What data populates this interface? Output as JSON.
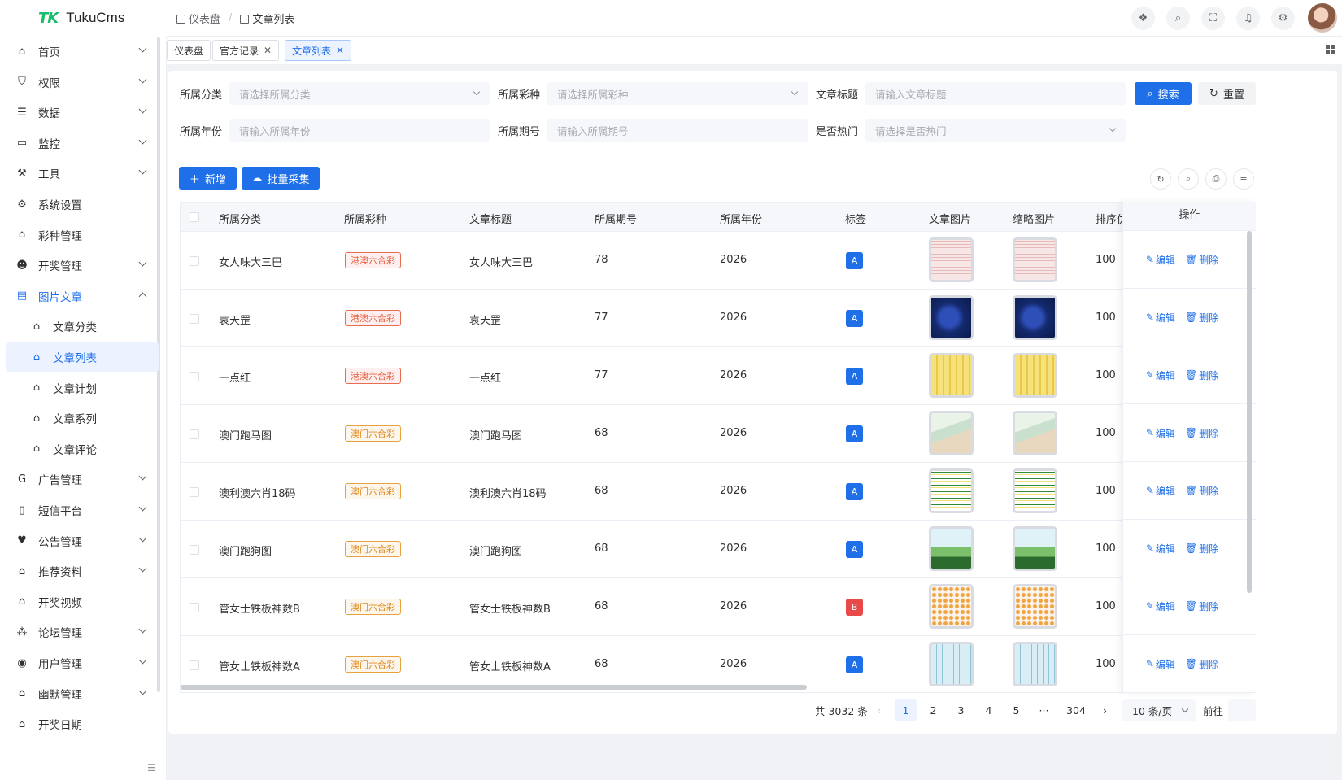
{
  "app": {
    "logo_mark": "TK",
    "name": "TukuCms"
  },
  "breadcrumb": [
    {
      "label": "仪表盘"
    },
    {
      "label": "文章列表"
    }
  ],
  "sidebar": {
    "items": [
      {
        "label": "首页",
        "icon": "home-icon",
        "expandable": true
      },
      {
        "label": "权限",
        "icon": "shield-icon",
        "expandable": true
      },
      {
        "label": "数据",
        "icon": "database-icon",
        "expandable": true
      },
      {
        "label": "监控",
        "icon": "monitor-icon",
        "expandable": true
      },
      {
        "label": "工具",
        "icon": "wrench-icon",
        "expandable": true
      },
      {
        "label": "系统设置",
        "icon": "gear-icon",
        "expandable": false
      },
      {
        "label": "彩种管理",
        "icon": "home-icon",
        "expandable": false
      },
      {
        "label": "开奖管理",
        "icon": "smile-icon",
        "expandable": true
      },
      {
        "label": "图片文章",
        "icon": "document-icon",
        "expandable": true,
        "open": true
      },
      {
        "label": "文章分类",
        "icon": "home-icon",
        "sub": true
      },
      {
        "label": "文章列表",
        "icon": "home-icon",
        "sub": true,
        "active": true
      },
      {
        "label": "文章计划",
        "icon": "home-icon",
        "sub": true
      },
      {
        "label": "文章系列",
        "icon": "home-icon",
        "sub": true
      },
      {
        "label": "文章评论",
        "icon": "home-icon",
        "sub": true
      },
      {
        "label": "广告管理",
        "icon": "google-icon",
        "expandable": true
      },
      {
        "label": "短信平台",
        "icon": "phone-icon",
        "expandable": true
      },
      {
        "label": "公告管理",
        "icon": "heart-icon",
        "expandable": true
      },
      {
        "label": "推荐资料",
        "icon": "home-icon",
        "expandable": true
      },
      {
        "label": "开奖视频",
        "icon": "home-icon",
        "expandable": false
      },
      {
        "label": "论坛管理",
        "icon": "network-icon",
        "expandable": true
      },
      {
        "label": "用户管理",
        "icon": "github-icon",
        "expandable": true
      },
      {
        "label": "幽默管理",
        "icon": "home-icon",
        "expandable": true
      },
      {
        "label": "开奖日期",
        "icon": "home-icon",
        "expandable": false
      }
    ]
  },
  "tabs": [
    {
      "label": "仪表盘",
      "closable": false
    },
    {
      "label": "官方记录",
      "closable": true
    },
    {
      "label": "文章列表",
      "closable": true,
      "active": true
    }
  ],
  "filters": {
    "category": {
      "label": "所属分类",
      "placeholder": "请选择所属分类"
    },
    "lottery": {
      "label": "所属彩种",
      "placeholder": "请选择所属彩种"
    },
    "title": {
      "label": "文章标题",
      "placeholder": "请输入文章标题"
    },
    "year": {
      "label": "所属年份",
      "placeholder": "请输入所属年份"
    },
    "issue": {
      "label": "所属期号",
      "placeholder": "请输入所属期号"
    },
    "hot": {
      "label": "是否热门",
      "placeholder": "请选择是否热门"
    },
    "search_label": "搜索",
    "reset_label": "重置"
  },
  "toolbar": {
    "add_label": "新增",
    "batch_label": "批量采集"
  },
  "table": {
    "columns": [
      "所属分类",
      "所属彩种",
      "文章标题",
      "所属期号",
      "所属年份",
      "标签",
      "文章图片",
      "缩略图片",
      "排序优",
      "操作"
    ],
    "edit_label": "编辑",
    "delete_label": "删除",
    "rows": [
      {
        "category": "女人味大三巴",
        "lottery": "港澳六合彩",
        "lottery_kind": "hk",
        "title": "女人味大三巴",
        "issue": "78",
        "year": "2026",
        "tag": "A",
        "sort": "100",
        "image_theme": "red-chart"
      },
      {
        "category": "袁天罡",
        "lottery": "港澳六合彩",
        "lottery_kind": "hk",
        "title": "袁天罡",
        "issue": "77",
        "year": "2026",
        "tag": "A",
        "sort": "100",
        "image_theme": "dark-blue"
      },
      {
        "category": "一点红",
        "lottery": "港澳六合彩",
        "lottery_kind": "hk",
        "title": "一点红",
        "issue": "77",
        "year": "2026",
        "tag": "A",
        "sort": "100",
        "image_theme": "yellow"
      },
      {
        "category": "澳门跑马图",
        "lottery": "澳门六合彩",
        "lottery_kind": "mo",
        "title": "澳门跑马图",
        "issue": "68",
        "year": "2026",
        "tag": "A",
        "sort": "100",
        "image_theme": "painting"
      },
      {
        "category": "澳利澳六肖18码",
        "lottery": "澳门六合彩",
        "lottery_kind": "mo",
        "title": "澳利澳六肖18码",
        "issue": "68",
        "year": "2026",
        "tag": "A",
        "sort": "100",
        "image_theme": "green-list"
      },
      {
        "category": "澳门跑狗图",
        "lottery": "澳门六合彩",
        "lottery_kind": "mo",
        "title": "澳门跑狗图",
        "issue": "68",
        "year": "2026",
        "tag": "A",
        "sort": "100",
        "image_theme": "cartoon"
      },
      {
        "category": "管女士铁板神数B",
        "lottery": "澳门六合彩",
        "lottery_kind": "mo",
        "title": "管女士铁板神数B",
        "issue": "68",
        "year": "2026",
        "tag": "B",
        "sort": "100",
        "image_theme": "grid-dots"
      },
      {
        "category": "管女士铁板神数A",
        "lottery": "澳门六合彩",
        "lottery_kind": "mo",
        "title": "管女士铁板神数A",
        "issue": "68",
        "year": "2026",
        "tag": "A",
        "sort": "100",
        "image_theme": "teal-grid"
      }
    ]
  },
  "pagination": {
    "total_text": "共 3032 条",
    "pages": [
      "1",
      "2",
      "3",
      "4",
      "5",
      "···",
      "304"
    ],
    "current": "1",
    "page_size": "10 条/页",
    "jump_label": "前往"
  },
  "colors": {
    "primary": "#1e6fe8",
    "hk_tag": "#e8623f",
    "mo_tag": "#e08a1e",
    "tag_b": "#e84a4a"
  }
}
